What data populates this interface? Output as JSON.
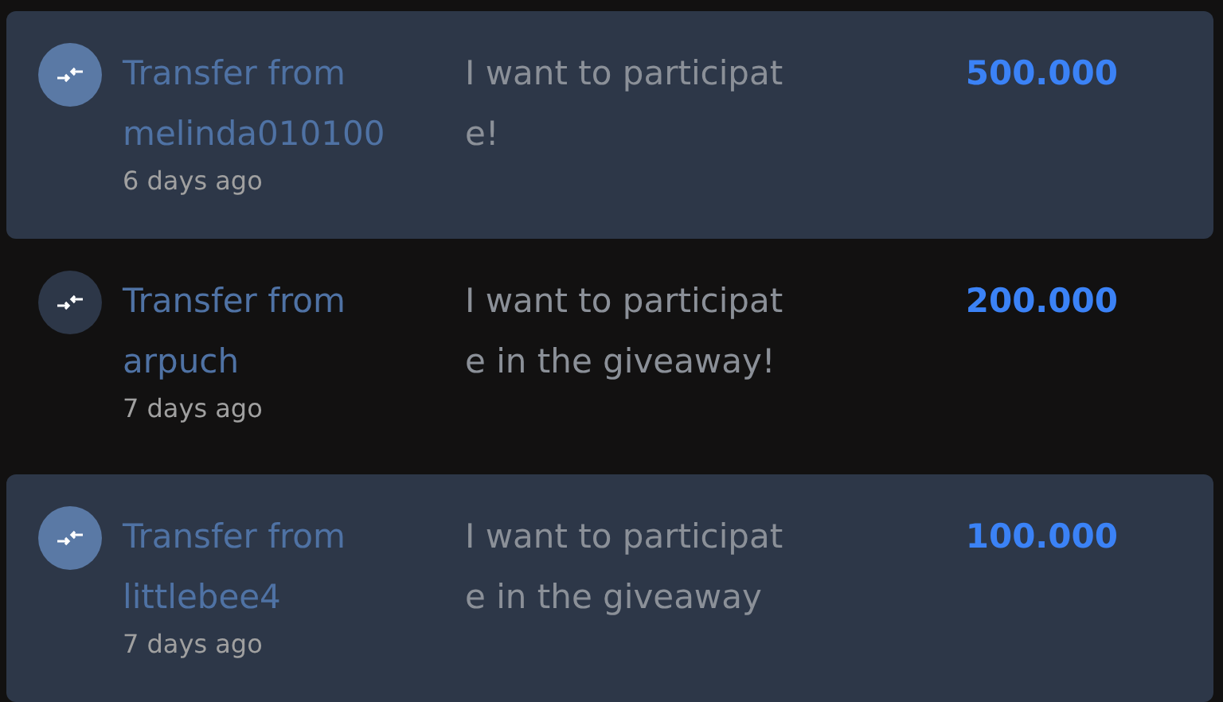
{
  "transactions": [
    {
      "title": "Transfer from melinda010100",
      "time": "6 days ago",
      "memo_lines": [
        "I want to participat",
        "e!"
      ],
      "amount": "500.000",
      "highlighted": true
    },
    {
      "title": "Transfer from arpuch",
      "time": "7 days ago",
      "memo_lines": [
        "I want to participat",
        "e in the giveaway!"
      ],
      "amount": "200.000",
      "highlighted": false
    },
    {
      "title": "Transfer from littlebee4",
      "time": "7 days ago",
      "memo_lines": [
        "I want to participat",
        "e in the giveaway"
      ],
      "amount": "100.000",
      "highlighted": true
    }
  ]
}
